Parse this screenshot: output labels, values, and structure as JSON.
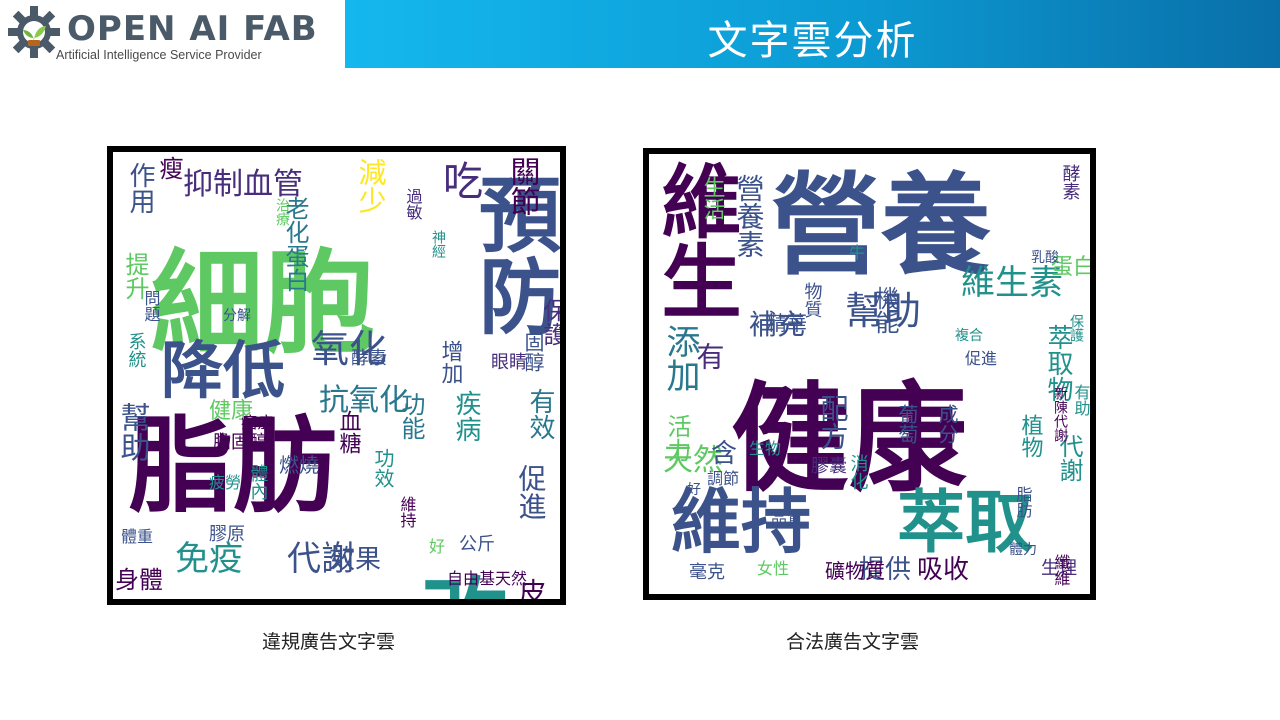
{
  "header": {
    "logo_title": "OPEN AI FAB",
    "logo_subtitle": "Artificial Intelligence Service Provider",
    "slide_title": "文字雲分析"
  },
  "colors": {
    "title_bar_start": "#14b8ee",
    "title_bar_end": "#0a6fa8",
    "cloud_palette": [
      "#440154",
      "#3b528b",
      "#21918c",
      "#5ec962",
      "#fde725",
      "#2a788e",
      "#472d7b"
    ]
  },
  "left_cloud": {
    "caption": "違規廣告文字雲",
    "words": [
      {
        "t": "細胞",
        "c": "#5ec962"
      },
      {
        "t": "脂肪",
        "c": "#440154"
      },
      {
        "t": "改善",
        "c": "#21918c"
      },
      {
        "t": "預防",
        "c": "#3b528b"
      },
      {
        "t": "降低",
        "c": "#3b528b"
      },
      {
        "t": "抑制血管",
        "c": "#472d7b"
      },
      {
        "t": "減少",
        "c": "#fde725"
      },
      {
        "t": "吃",
        "c": "#472d7b"
      },
      {
        "t": "關節",
        "c": "#440154"
      },
      {
        "t": "氧化",
        "c": "#3b528b"
      },
      {
        "t": "抗氧化",
        "c": "#2a788e"
      },
      {
        "t": "免疫",
        "c": "#21918c"
      },
      {
        "t": "代謝",
        "c": "#3b528b"
      },
      {
        "t": "身體",
        "c": "#440154"
      },
      {
        "t": "效果",
        "c": "#3b528b"
      },
      {
        "t": "皮膚",
        "c": "#440154"
      },
      {
        "t": "促進",
        "c": "#3b528b"
      },
      {
        "t": "有效",
        "c": "#2a788e"
      },
      {
        "t": "健康",
        "c": "#5ec962"
      },
      {
        "t": "幫助",
        "c": "#3b528b"
      },
      {
        "t": "疾病",
        "c": "#21918c"
      },
      {
        "t": "保護",
        "c": "#472d7b"
      },
      {
        "t": "瘦",
        "c": "#440154"
      },
      {
        "t": "作用",
        "c": "#3b528b"
      },
      {
        "t": "提升",
        "c": "#5ec962"
      },
      {
        "t": "膽固醇",
        "c": "#440154"
      },
      {
        "t": "老化蛋白",
        "c": "#2a788e"
      },
      {
        "t": "功能",
        "c": "#2a788e"
      },
      {
        "t": "血糖",
        "c": "#440154"
      },
      {
        "t": "增加",
        "c": "#3b528b"
      },
      {
        "t": "燃燒",
        "c": "#3b528b"
      },
      {
        "t": "固醇",
        "c": "#3b528b"
      },
      {
        "t": "酵素",
        "c": "#3b528b"
      },
      {
        "t": "眼睛",
        "c": "#472d7b"
      },
      {
        "t": "系統",
        "c": "#21918c"
      },
      {
        "t": "自由基天然",
        "c": "#440154"
      },
      {
        "t": "功效",
        "c": "#21918c"
      },
      {
        "t": "好",
        "c": "#5ec962"
      },
      {
        "t": "體重",
        "c": "#3b528b"
      },
      {
        "t": "膠原",
        "c": "#3b528b"
      },
      {
        "t": "公斤",
        "c": "#3b528b"
      },
      {
        "t": "維持",
        "c": "#440154"
      },
      {
        "t": "體內",
        "c": "#21918c"
      },
      {
        "t": "癌症",
        "c": "#440154"
      },
      {
        "t": "疲勞",
        "c": "#21918c"
      },
      {
        "t": "分解",
        "c": "#3b528b"
      },
      {
        "t": "問題",
        "c": "#3b528b"
      },
      {
        "t": "過敏",
        "c": "#472d7b"
      },
      {
        "t": "神經",
        "c": "#21918c"
      },
      {
        "t": "治療",
        "c": "#5ec962"
      }
    ]
  },
  "right_cloud": {
    "caption": "合法廣告文字雲",
    "words": [
      {
        "t": "營養",
        "c": "#3b528b"
      },
      {
        "t": "健康",
        "c": "#440154"
      },
      {
        "t": "維生",
        "c": "#440154"
      },
      {
        "t": "維持",
        "c": "#3b528b"
      },
      {
        "t": "萃取",
        "c": "#21918c"
      },
      {
        "t": "幫助",
        "c": "#3b528b"
      },
      {
        "t": "維生素",
        "c": "#21918c"
      },
      {
        "t": "補充",
        "c": "#3b528b"
      },
      {
        "t": "添加",
        "c": "#2a788e"
      },
      {
        "t": "有",
        "c": "#472d7b"
      },
      {
        "t": "天然",
        "c": "#5ec962"
      },
      {
        "t": "活力",
        "c": "#5ec962"
      },
      {
        "t": "含",
        "c": "#3b528b"
      },
      {
        "t": "配方",
        "c": "#3b528b"
      },
      {
        "t": "提供",
        "c": "#3b528b"
      },
      {
        "t": "吸收",
        "c": "#440154"
      },
      {
        "t": "機能",
        "c": "#3b528b"
      },
      {
        "t": "營養素",
        "c": "#3b528b"
      },
      {
        "t": "萃取物",
        "c": "#21918c"
      },
      {
        "t": "蛋白",
        "c": "#5ec962"
      },
      {
        "t": "生活",
        "c": "#5ec962"
      },
      {
        "t": "精華",
        "c": "#3b528b"
      },
      {
        "t": "代謝",
        "c": "#21918c"
      },
      {
        "t": "植物",
        "c": "#21918c"
      },
      {
        "t": "葡萄",
        "c": "#3b528b"
      },
      {
        "t": "成分",
        "c": "#3b528b"
      },
      {
        "t": "消化",
        "c": "#21918c"
      },
      {
        "t": "膠囊",
        "c": "#472d7b"
      },
      {
        "t": "礦物質",
        "c": "#440154"
      },
      {
        "t": "毫克",
        "c": "#3b528b"
      },
      {
        "t": "女性",
        "c": "#5ec962"
      },
      {
        "t": "生理",
        "c": "#472d7b"
      },
      {
        "t": "調節",
        "c": "#3b528b"
      },
      {
        "t": "酵素",
        "c": "#472d7b"
      },
      {
        "t": "促進",
        "c": "#3b528b"
      },
      {
        "t": "生物",
        "c": "#21918c"
      },
      {
        "t": "品質",
        "c": "#3b528b"
      },
      {
        "t": "牛",
        "c": "#21918c"
      },
      {
        "t": "物質",
        "c": "#3b528b"
      },
      {
        "t": "複合",
        "c": "#21918c"
      },
      {
        "t": "新陳代謝",
        "c": "#440154"
      },
      {
        "t": "乳酸",
        "c": "#3b528b"
      },
      {
        "t": "保護",
        "c": "#21918c"
      },
      {
        "t": "有助",
        "c": "#21918c"
      },
      {
        "t": "脂肪",
        "c": "#3b528b"
      },
      {
        "t": "纖維",
        "c": "#440154"
      },
      {
        "t": "體力",
        "c": "#3b528b"
      },
      {
        "t": "好",
        "c": "#3b528b"
      }
    ]
  }
}
